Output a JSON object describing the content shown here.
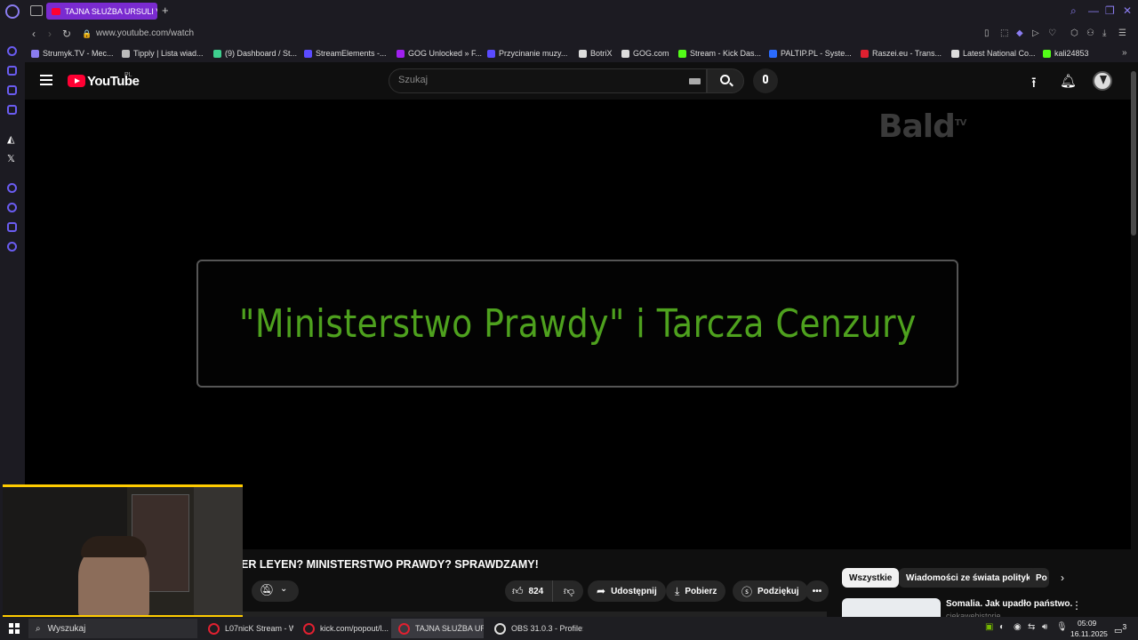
{
  "browser": {
    "active_tab_title": "TAJNA SŁUŻBA URSULI V",
    "url": "www.youtube.com/watch",
    "bookmarks": [
      {
        "label": "Strumyk.TV - Mec...",
        "color": "#8a7cf0"
      },
      {
        "label": "Tipply | Lista wiad...",
        "color": "#bbbbbb"
      },
      {
        "label": "(9) Dashboard / St...",
        "color": "#3ecf8e"
      },
      {
        "label": "StreamElements -...",
        "color": "#5a4bff"
      },
      {
        "label": "GOG Unlocked » F...",
        "color": "#a020f0"
      },
      {
        "label": "Przycinanie muzy...",
        "color": "#5a4bff"
      },
      {
        "label": "BotriX",
        "color": "#dddddd"
      },
      {
        "label": "GOG.com",
        "color": "#dddddd"
      },
      {
        "label": "Stream - Kick Das...",
        "color": "#53fc18"
      },
      {
        "label": "PALTIP.PL - Syste...",
        "color": "#2b6cff"
      },
      {
        "label": "Raszei.eu - Trans...",
        "color": "#e02030"
      },
      {
        "label": "Latest National Co...",
        "color": "#dddddd"
      },
      {
        "label": "kali24853",
        "color": "#53fc18"
      }
    ]
  },
  "youtube": {
    "logo_text": "YouTube",
    "country_code": "PL",
    "search_placeholder": "Szukaj",
    "video": {
      "watermark": "Bald",
      "watermark_sup": "TV",
      "frame_text": "\"Ministerstwo Prawdy\" i Tarcza Cenzury"
    },
    "title": "DER LEYEN? MINISTERSTWO PRAWDY? SPRAWDZAMY!",
    "actions": {
      "like_count": "824",
      "share": "Udostępnij",
      "download": "Pobierz",
      "thanks": "Podziękuj"
    },
    "chips": [
      "Wszystkie",
      "Wiadomości ze świata polityki",
      "Po"
    ],
    "recommended": {
      "title": "Somalia. Jak upadło państwo.",
      "channel": "ciekawehistorie"
    }
  },
  "taskbar": {
    "search_label": "Wyszukaj",
    "apps": [
      {
        "label": "L07nicK Stream - W...",
        "kind": "opera"
      },
      {
        "label": "kick.com/popout/l...",
        "kind": "opera"
      },
      {
        "label": "TAJNA SŁUŻBA UR...",
        "kind": "opera"
      },
      {
        "label": "OBS 31.0.3 - Profile:...",
        "kind": "obs"
      }
    ],
    "time": "05:09",
    "date": "16.11.2025",
    "notifications": "3"
  }
}
